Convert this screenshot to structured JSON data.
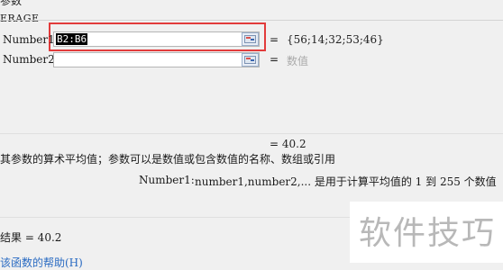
{
  "dialog": {
    "title_fragment": "参数"
  },
  "function_group": {
    "name": "ERAGE"
  },
  "args": [
    {
      "label": "Number1",
      "input_value": "B2:B6",
      "equals": "=",
      "result": "{56;14;32;53;46}"
    },
    {
      "label": "Number2",
      "input_value": "",
      "equals": "=",
      "result": "数值"
    }
  ],
  "formula_result_preview": "= 40.2",
  "description": "其参数的算术平均值；参数可以是数值或包含数值的名称、数组或引用",
  "arg_help": {
    "name": "Number1:",
    "text": "number1,number2,... 是用于计算平均值的 1 到 255 个数值"
  },
  "calc_result": "结果 = 40.2",
  "help_link": "该函数的帮助(H)",
  "watermark": "软件技巧"
}
